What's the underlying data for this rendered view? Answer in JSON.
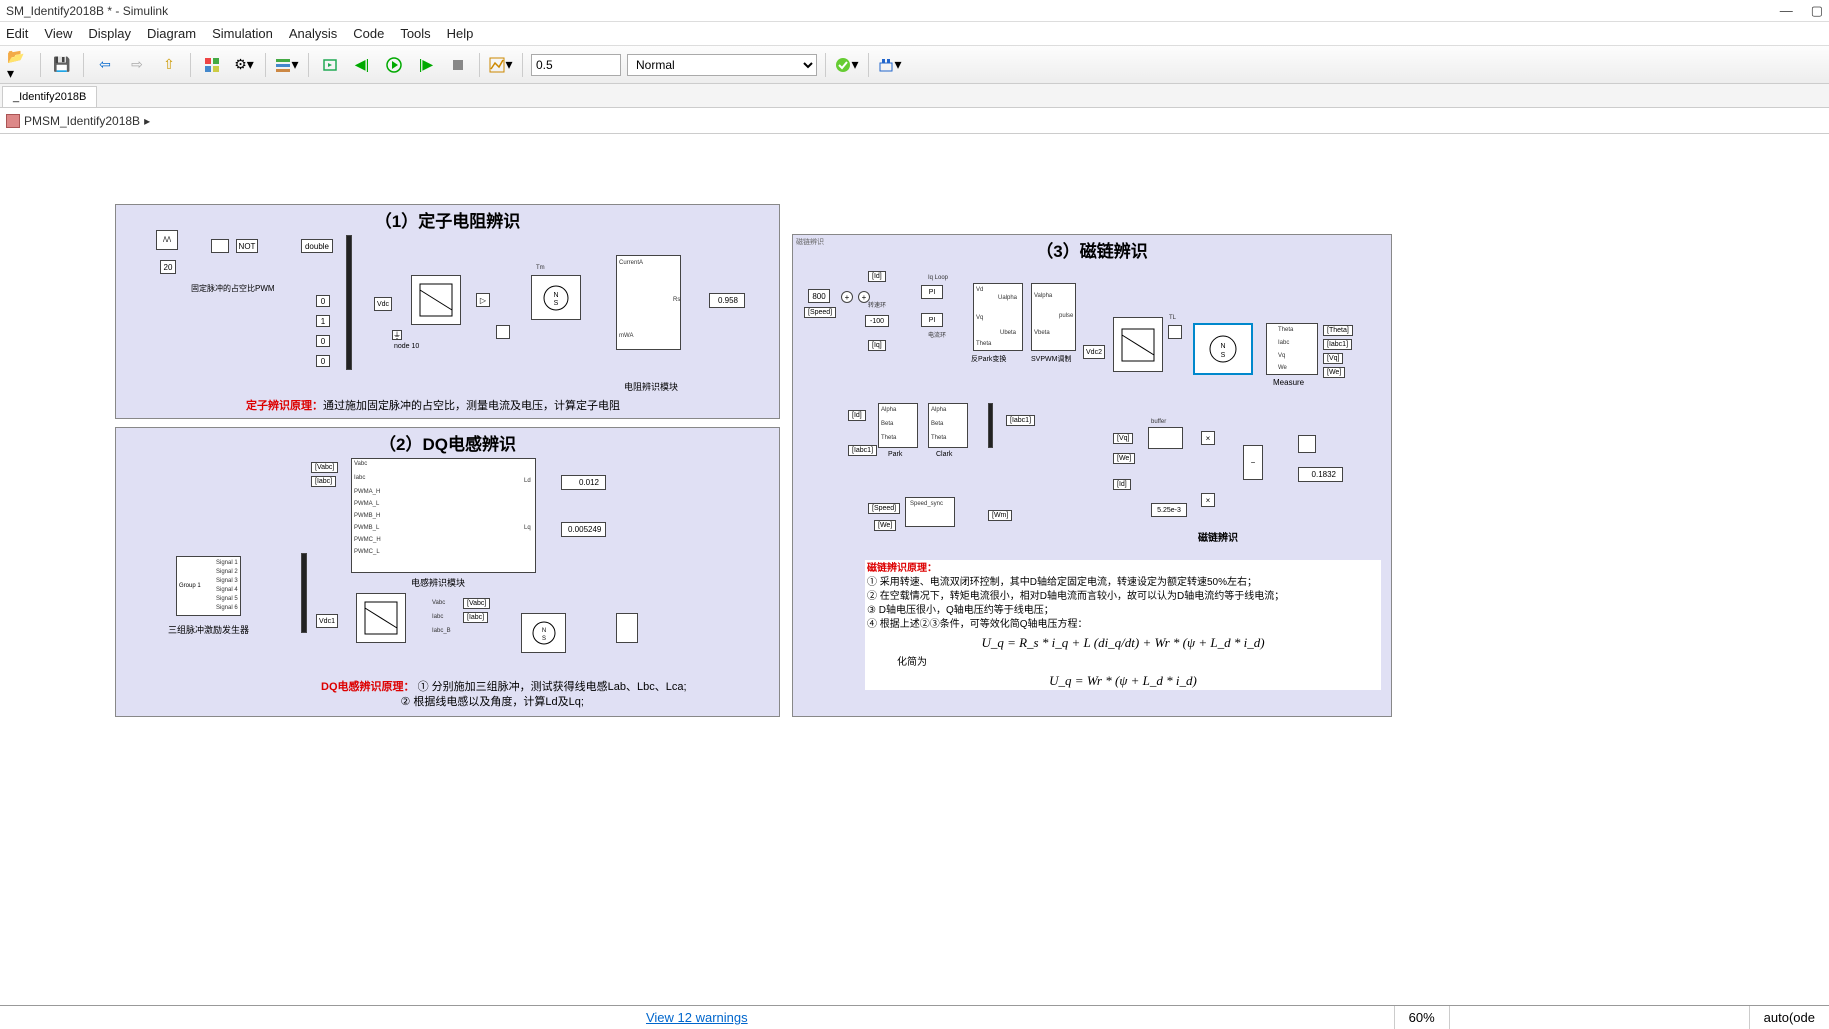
{
  "window": {
    "title": "SM_Identify2018B * - Simulink"
  },
  "menu": {
    "edit": "Edit",
    "view": "View",
    "display": "Display",
    "diagram": "Diagram",
    "simulation": "Simulation",
    "analysis": "Analysis",
    "code": "Code",
    "tools": "Tools",
    "help": "Help"
  },
  "toolbar": {
    "stoptime": "0.5",
    "mode": "Normal"
  },
  "tab": {
    "name": "_Identify2018B"
  },
  "breadcrumb": {
    "model": "PMSM_Identify2018B"
  },
  "region1": {
    "title": "（1）定子电阻辨识",
    "pwm_note": "固定脉冲的占空比PWM",
    "const20": "20",
    "not": "NOT",
    "double": "double",
    "const0a": "0",
    "const1": "1",
    "const0b": "0",
    "const0c": "0",
    "vdc": "Vdc",
    "tm": "Tm",
    "currentA": "CurrentA",
    "mWA": "mWA",
    "rs": "Rs",
    "rs_val": "0.958",
    "rs_block_label": "电阻辨识模块",
    "node": "node 10",
    "principle_label": "定子辨识原理：",
    "principle_text": "通过施加固定脉冲的占空比，测量电流及电压，计算定子电阻"
  },
  "region2": {
    "title": "（2）DQ电感辨识",
    "vabc": "[Vabc]",
    "iabc": "[Iabc]",
    "ports": {
      "vabc": "Vabc",
      "iabc": "Iabc",
      "pwma_h": "PWMA_H",
      "pwma_l": "PWMA_L",
      "pwmb_h": "PWMB_H",
      "pwmb_l": "PWMB_L",
      "pwmc_h": "PWMC_H",
      "pwmc_l": "PWMC_L"
    },
    "ld": "Ld",
    "lq": "Lq",
    "ld_val": "0.012",
    "lq_val": "0.005249",
    "block_label": "电感辨识模块",
    "sig_group": "Group 1",
    "sigs": {
      "s1": "Signal 1",
      "s2": "Signal 2",
      "s3": "Signal 3",
      "s4": "Signal 4",
      "s5": "Signal 5",
      "s6": "Signal 6"
    },
    "gen_label": "三组脉冲激励发生器",
    "vdc1": "Vdc1",
    "goto_vabc": "[Vabc]",
    "goto_iabc": "[Iabc]",
    "inv_ports": {
      "vabc": "Vabc",
      "iabc": "Iabc",
      "iabc_b": "Iabc_B"
    },
    "principle_label": "DQ电感辨识原理：",
    "principle_1": "① 分别施加三组脉冲，测试获得线电感Lab、Lbc、Lca;",
    "principle_2": "② 根据线电感以及角度，计算Ld及Lq;"
  },
  "region3": {
    "region_name": "磁链辨识",
    "title": "（3）磁链辨识",
    "const800": "800",
    "constm100": "-100",
    "speed": "[Speed]",
    "id_in": "[Id]",
    "iq_in": "[Iq]",
    "id2": "[Id]",
    "iqloop": "Iq Loop",
    "spdloop": "转速环",
    "curloop": "电流环",
    "ipark": "反Park变换",
    "svpwm": "SVPWM调制",
    "vdc2": "Vdc2",
    "measure": "Measure",
    "tl": "TL",
    "outs": {
      "theta": "[Theta]",
      "iabc": "[Iabc1]",
      "vq": "[Vq]",
      "we": "[We]"
    },
    "meas_ports": {
      "theta": "Theta",
      "iabc": "Iabc",
      "vq": "Vq",
      "we": "We"
    },
    "ipark_ports": {
      "vd": "Vd",
      "vq": "Vq",
      "theta": "Theta",
      "ualpha": "Ualpha",
      "ubeta": "Ubeta"
    },
    "svpwm_ports": {
      "valpha": "Valpha",
      "vbeta": "Vbeta",
      "pulse": "pulse"
    },
    "park_block": "Park",
    "clark_block": "Clark",
    "park_ports": {
      "alpha": "Alpha",
      "beta": "Beta",
      "theta": "Theta"
    },
    "clark_ports": {
      "alpha": "Alpha",
      "beta": "Beta",
      "theta": "Theta"
    },
    "iabc1_in": "[Iabc1]",
    "speed_sync": "Speed_sync",
    "we_in": "[We]",
    "wm_out": "[Wm]",
    "flux_label": "磁链辨识",
    "vq_in": "[Vq]",
    "weN": "[We]",
    "idN": "[Id]",
    "gain525": "5.25e-3",
    "flux_val": "0.1832",
    "principle_label": "磁链辨识原理：",
    "p1": "① 采用转速、电流双闭环控制，其中D轴给定固定电流，转速设定为额定转速50%左右；",
    "p2": "② 在空载情况下，转矩电流很小，相对D轴电流而言较小，故可以认为D轴电流约等于线电流；",
    "p3": "③ D轴电压很小，Q轴电压约等于线电压；",
    "p4": "④ 根据上述②③条件，可等效化简Q轴电压方程：",
    "eq1": "U_q = R_s * i_q + L (di_q/dt) + Wr * (ψ + L_d * i_d)",
    "simplify": "化简为",
    "eq2": "U_q = Wr * (ψ + L_d * i_d)"
  },
  "status": {
    "warnings": "View 12 warnings",
    "zoom": "60%",
    "solver": "auto(ode"
  }
}
